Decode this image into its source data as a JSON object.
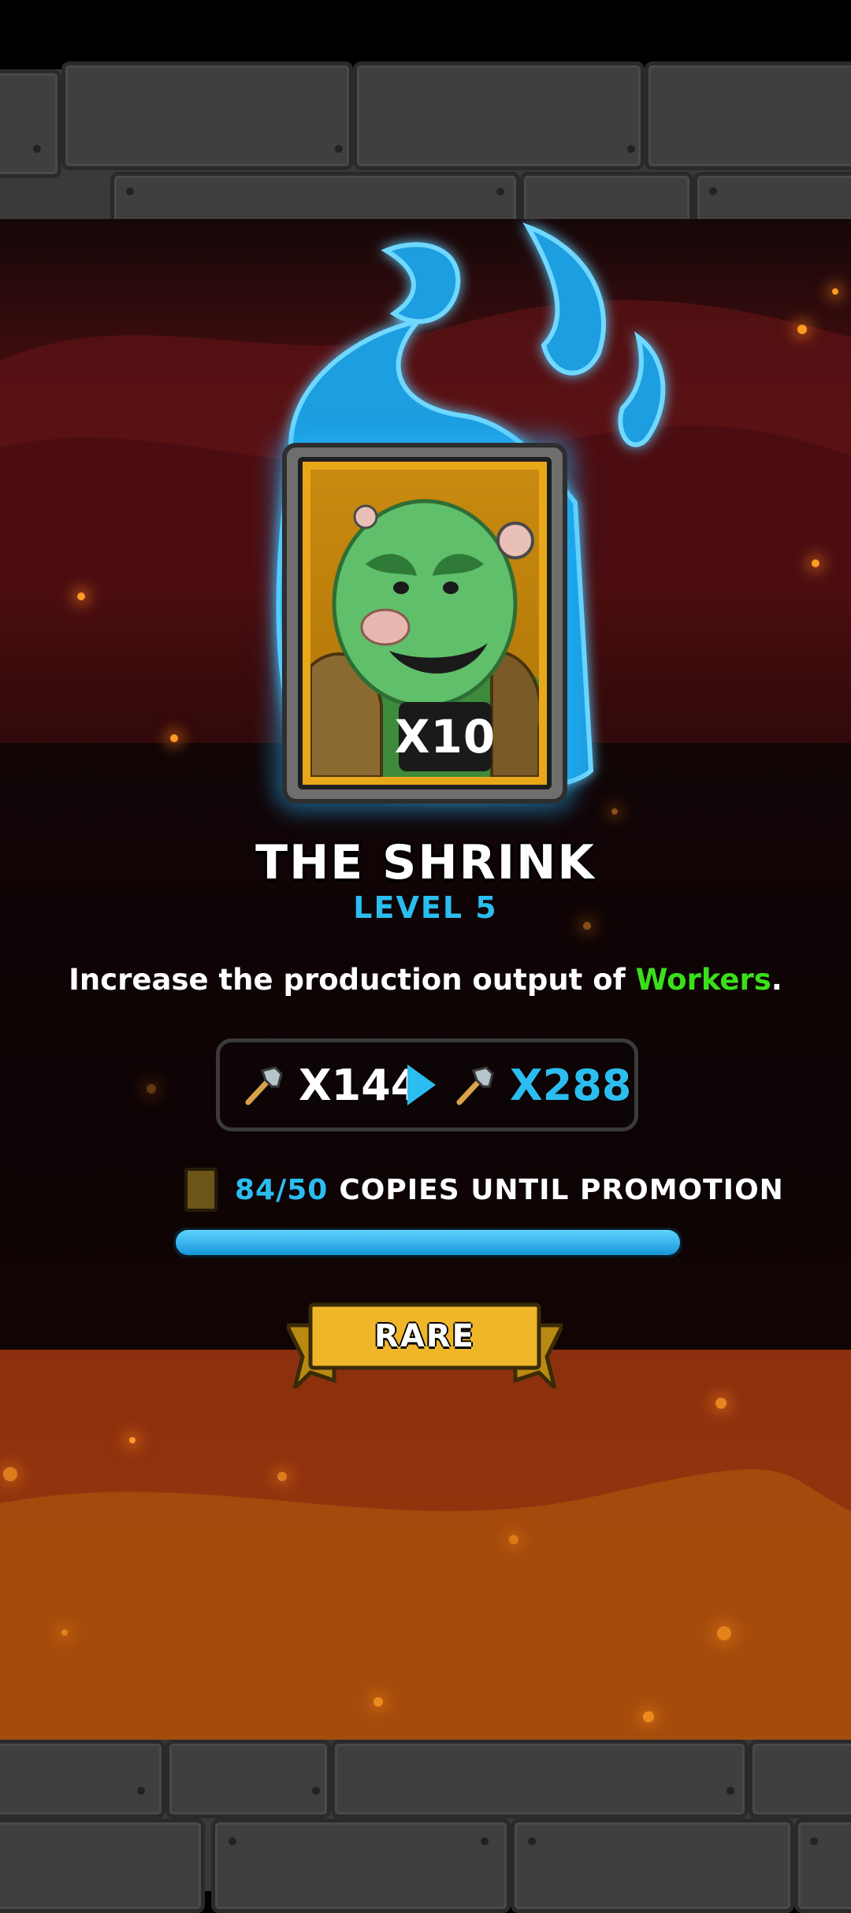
{
  "card": {
    "name": "THE SHRINK",
    "level": "LEVEL 5",
    "count": "X10",
    "rarity": "RARE"
  },
  "description": {
    "prefix": "Increase the production output of ",
    "highlight": "Workers",
    "suffix": "."
  },
  "boost": {
    "current": "X144",
    "next": "X288",
    "icon": "hammer-icon"
  },
  "promotion": {
    "copies": "84/50",
    "label": "COPIES UNTIL PROMOTION",
    "progress_fraction": 1.0
  },
  "colors": {
    "accent_blue": "#2bbdf0",
    "highlight_green": "#39e01a",
    "ribbon_gold": "#f0b62a"
  }
}
